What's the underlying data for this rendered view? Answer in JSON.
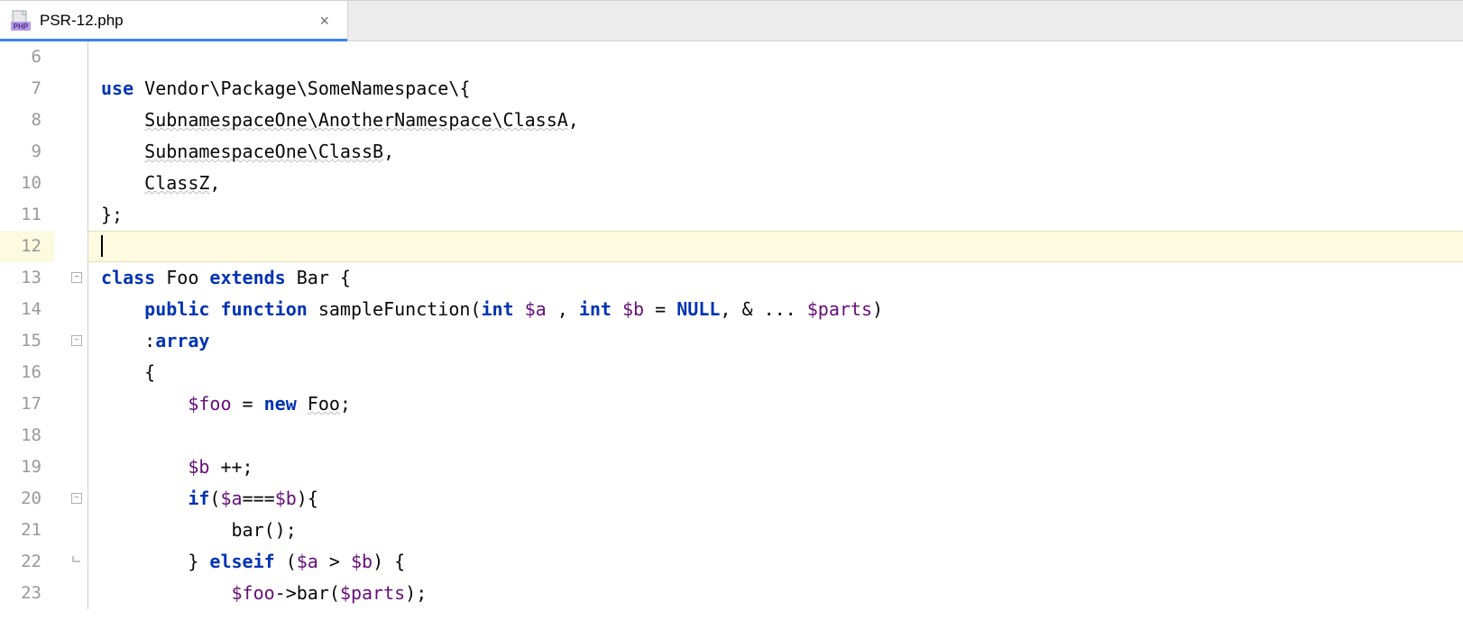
{
  "tab": {
    "filename": "PSR-12.php",
    "icon_label": "PHP"
  },
  "lines": [
    {
      "n": 6,
      "tokens": []
    },
    {
      "n": 7,
      "tokens": [
        {
          "t": "use ",
          "c": "kw"
        },
        {
          "t": "Vendor\\Package\\SomeNamespace\\{",
          "c": "plain"
        }
      ]
    },
    {
      "n": 8,
      "indent": 1,
      "tokens": [
        {
          "t": "    ",
          "c": "plain"
        },
        {
          "t": "SubnamespaceOne\\AnotherNamespace\\ClassA",
          "c": "plain",
          "squiggle": true
        },
        {
          "t": ",",
          "c": "plain"
        }
      ]
    },
    {
      "n": 9,
      "indent": 1,
      "tokens": [
        {
          "t": "    ",
          "c": "plain"
        },
        {
          "t": "SubnamespaceOne\\ClassB",
          "c": "plain",
          "squiggle": true
        },
        {
          "t": ",",
          "c": "plain"
        }
      ]
    },
    {
      "n": 10,
      "indent": 1,
      "tokens": [
        {
          "t": "    ",
          "c": "plain"
        },
        {
          "t": "ClassZ",
          "c": "plain",
          "squiggle": true
        },
        {
          "t": ",",
          "c": "plain"
        }
      ]
    },
    {
      "n": 11,
      "tokens": [
        {
          "t": "};",
          "c": "plain"
        }
      ]
    },
    {
      "n": 12,
      "highlight": true,
      "caret": true,
      "tokens": []
    },
    {
      "n": 13,
      "fold": "start",
      "tokens": [
        {
          "t": "class ",
          "c": "kw"
        },
        {
          "t": "Foo ",
          "c": "plain"
        },
        {
          "t": "extends ",
          "c": "kw"
        },
        {
          "t": "Bar {",
          "c": "plain"
        }
      ]
    },
    {
      "n": 14,
      "indent": 1,
      "tokens": [
        {
          "t": "    ",
          "c": "plain"
        },
        {
          "t": "public function ",
          "c": "kw"
        },
        {
          "t": "sampleFunction(",
          "c": "plain"
        },
        {
          "t": "int ",
          "c": "kw"
        },
        {
          "t": "$a",
          "c": "var"
        },
        {
          "t": " , ",
          "c": "plain"
        },
        {
          "t": "int ",
          "c": "kw"
        },
        {
          "t": "$b",
          "c": "var"
        },
        {
          "t": " = ",
          "c": "plain"
        },
        {
          "t": "NULL",
          "c": "const"
        },
        {
          "t": ", & ... ",
          "c": "plain"
        },
        {
          "t": "$parts",
          "c": "var"
        },
        {
          "t": ")",
          "c": "plain"
        }
      ]
    },
    {
      "n": 15,
      "fold": "start",
      "indent": 1,
      "tokens": [
        {
          "t": "    :",
          "c": "plain"
        },
        {
          "t": "array",
          "c": "kw"
        }
      ]
    },
    {
      "n": 16,
      "indent": 1,
      "tokens": [
        {
          "t": "    {",
          "c": "plain"
        }
      ]
    },
    {
      "n": 17,
      "indent": 2,
      "tokens": [
        {
          "t": "        ",
          "c": "plain"
        },
        {
          "t": "$foo",
          "c": "var"
        },
        {
          "t": " = ",
          "c": "plain"
        },
        {
          "t": "new ",
          "c": "kw"
        },
        {
          "t": "Foo",
          "c": "plain",
          "squiggle": true
        },
        {
          "t": ";",
          "c": "plain"
        }
      ]
    },
    {
      "n": 18,
      "indent": 1,
      "tokens": []
    },
    {
      "n": 19,
      "indent": 2,
      "tokens": [
        {
          "t": "        ",
          "c": "plain"
        },
        {
          "t": "$b",
          "c": "var"
        },
        {
          "t": " ++;",
          "c": "plain"
        }
      ]
    },
    {
      "n": 20,
      "fold": "start",
      "indent": 2,
      "tokens": [
        {
          "t": "        ",
          "c": "plain"
        },
        {
          "t": "if",
          "c": "kw"
        },
        {
          "t": "(",
          "c": "plain"
        },
        {
          "t": "$a",
          "c": "var"
        },
        {
          "t": "===",
          "c": "plain"
        },
        {
          "t": "$b",
          "c": "var"
        },
        {
          "t": "){",
          "c": "plain"
        }
      ]
    },
    {
      "n": 21,
      "indent": 3,
      "tokens": [
        {
          "t": "            bar();",
          "c": "plain"
        }
      ]
    },
    {
      "n": 22,
      "fold": "end",
      "indent": 2,
      "tokens": [
        {
          "t": "        } ",
          "c": "plain"
        },
        {
          "t": "elseif ",
          "c": "kw"
        },
        {
          "t": "(",
          "c": "plain"
        },
        {
          "t": "$a",
          "c": "var"
        },
        {
          "t": " > ",
          "c": "plain"
        },
        {
          "t": "$b",
          "c": "var"
        },
        {
          "t": ") {",
          "c": "plain"
        }
      ]
    },
    {
      "n": 23,
      "indent": 3,
      "tokens": [
        {
          "t": "            ",
          "c": "plain"
        },
        {
          "t": "$foo",
          "c": "var"
        },
        {
          "t": "->bar(",
          "c": "plain"
        },
        {
          "t": "$parts",
          "c": "var"
        },
        {
          "t": ");",
          "c": "plain"
        }
      ]
    }
  ]
}
